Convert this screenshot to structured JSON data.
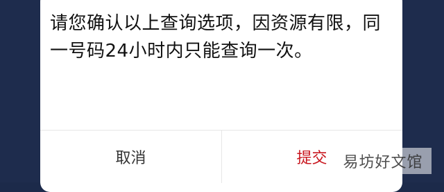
{
  "dialog": {
    "message": "请您确认以上查询选项，因资源有限，同一号码24小时内只能查询一次。",
    "cancel_label": "取消",
    "submit_label": "提交"
  },
  "watermark": {
    "text": "易坊好文馆"
  },
  "colors": {
    "backdrop": "#1e2c4d",
    "dialog_bg": "#ffffff",
    "submit_text": "#c8151d",
    "cancel_text": "#333333"
  }
}
